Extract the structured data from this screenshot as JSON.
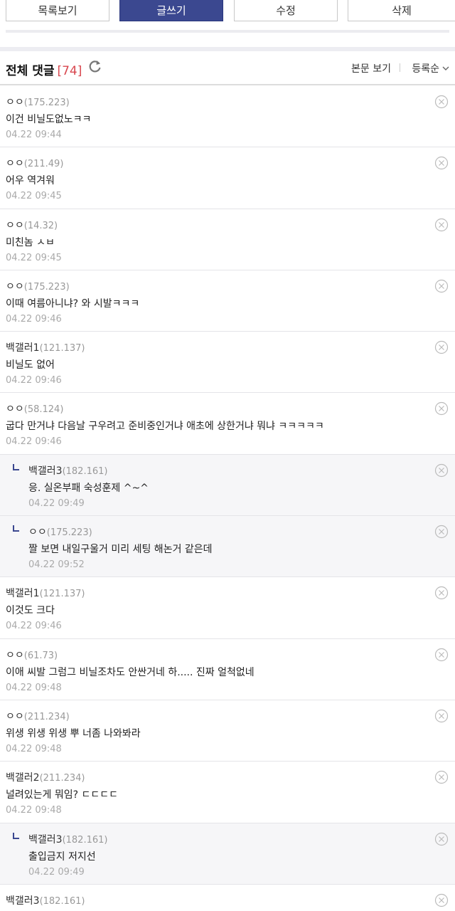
{
  "buttons": {
    "list": "목록보기",
    "write": "글쓰기",
    "edit": "수정",
    "delete": "삭제"
  },
  "comments_header": {
    "title": "전체 댓글",
    "count": "[74]",
    "view_body": "본문 보기",
    "sort": "등록순"
  },
  "colors": {
    "primary": "#3b4890",
    "count": "#d8474f"
  },
  "comments": [
    {
      "reply": false,
      "name": "ㅇㅇ",
      "ip": "(175.223)",
      "content": "이건 비닐도없노ㅋㅋ",
      "date": "04.22 09:44"
    },
    {
      "reply": false,
      "name": "ㅇㅇ",
      "ip": "(211.49)",
      "content": "어우 역겨워",
      "date": "04.22 09:45"
    },
    {
      "reply": false,
      "name": "ㅇㅇ",
      "ip": "(14.32)",
      "content": "미친놈 ㅅㅂ",
      "date": "04.22 09:45"
    },
    {
      "reply": false,
      "name": "ㅇㅇ",
      "ip": "(175.223)",
      "content": "이때 여름아니냐? 와 시발ㅋㅋㅋ",
      "date": "04.22 09:46"
    },
    {
      "reply": false,
      "name": "백갤러1",
      "ip": "(121.137)",
      "content": "비닐도 없어",
      "date": "04.22 09:46"
    },
    {
      "reply": false,
      "name": "ㅇㅇ",
      "ip": "(58.124)",
      "content": "굽다 만거냐 다음날 구우려고 준비중인거냐 애초에 상한거냐 뭐냐 ㅋㅋㅋㅋㅋ",
      "date": "04.22 09:46"
    },
    {
      "reply": true,
      "name": "백갤러3",
      "ip": "(182.161)",
      "content": "응. 실온부패 숙성훈제 ^~^",
      "date": "04.22 09:49"
    },
    {
      "reply": true,
      "name": "ㅇㅇ",
      "ip": "(175.223)",
      "content": "짤 보면 내일구울거 미리 세팅 해논거 같은데",
      "date": "04.22 09:52"
    },
    {
      "reply": false,
      "name": "백갤러1",
      "ip": "(121.137)",
      "content": "이것도 크다",
      "date": "04.22 09:46"
    },
    {
      "reply": false,
      "name": "ㅇㅇ",
      "ip": "(61.73)",
      "content": "이애 씨발 그럼그 비닐조차도 안싼거네 하..... 진짜 얼척없네",
      "date": "04.22 09:48"
    },
    {
      "reply": false,
      "name": "ㅇㅇ",
      "ip": "(211.234)",
      "content": "위생 위생 위생 뿌 너좀 나와봐라",
      "date": "04.22 09:48"
    },
    {
      "reply": false,
      "name": "백갤러2",
      "ip": "(211.234)",
      "content": "널려있는게 뭐임? ㄷㄷㄷㄷ",
      "date": "04.22 09:48"
    },
    {
      "reply": true,
      "name": "백갤러3",
      "ip": "(182.161)",
      "content": "출입금지 저지선",
      "date": "04.22 09:49"
    },
    {
      "reply": false,
      "name": "백갤러3",
      "ip": "(182.161)",
      "content": "",
      "date": ""
    }
  ]
}
